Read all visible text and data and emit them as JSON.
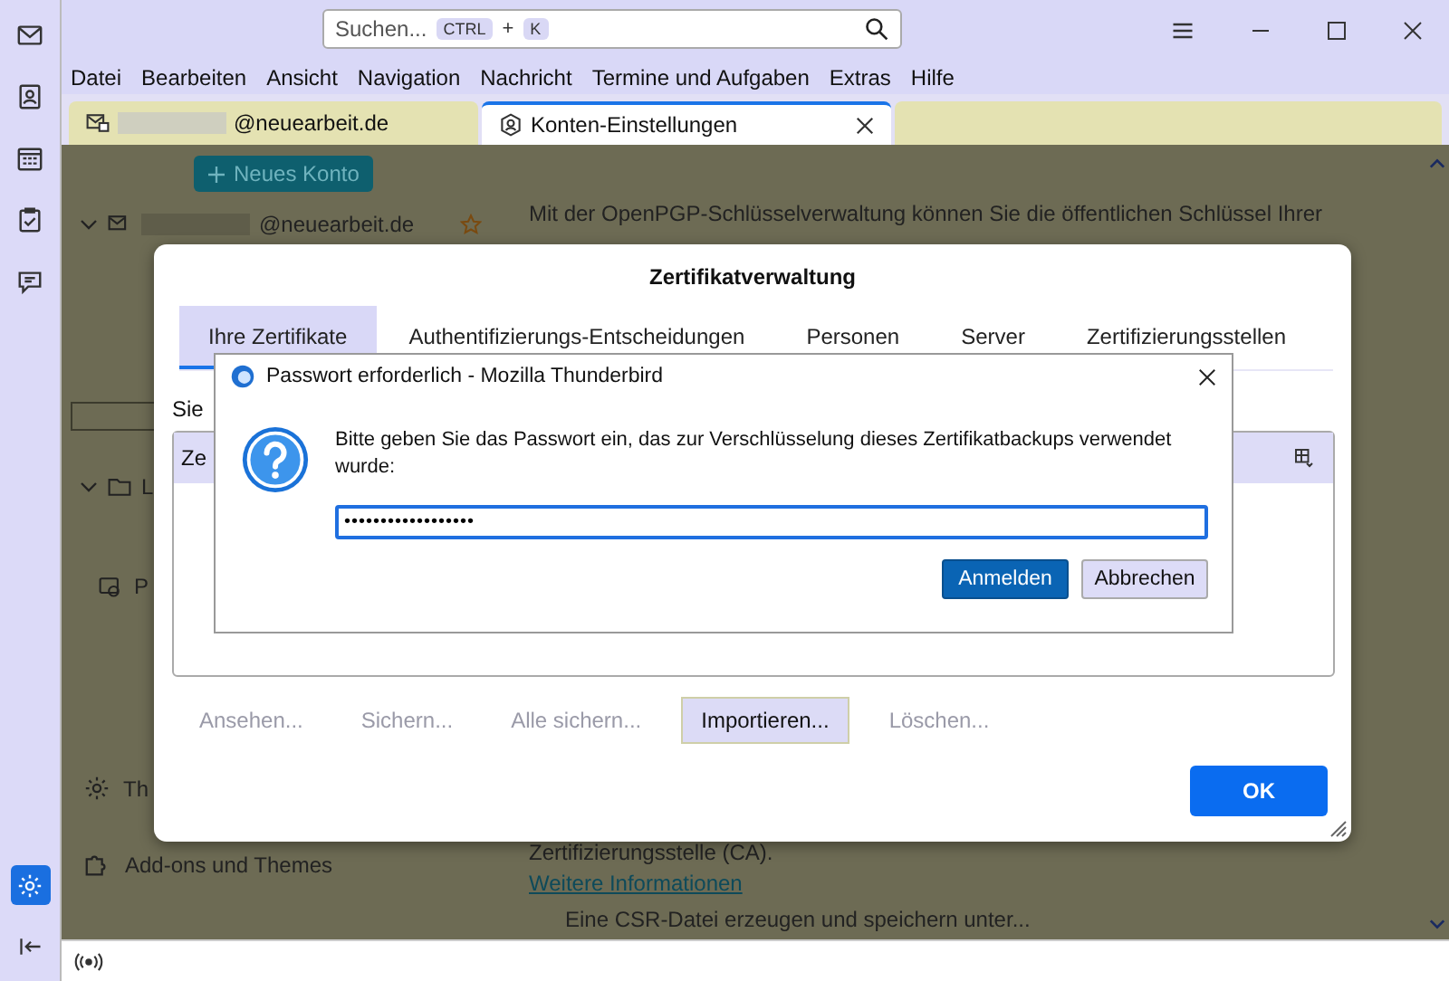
{
  "search": {
    "placeholder": "Suchen...",
    "keys": [
      "CTRL",
      "K"
    ],
    "joiner": "+"
  },
  "menu": [
    {
      "label": "Datei"
    },
    {
      "label": "Bearbeiten"
    },
    {
      "label": "Ansicht"
    },
    {
      "label": "Navigation"
    },
    {
      "label": "Nachricht"
    },
    {
      "label": "Termine und Aufgaben"
    },
    {
      "label": "Extras"
    },
    {
      "label": "Hilfe"
    }
  ],
  "spaces": [
    {
      "selected": false
    },
    {
      "selected": false
    },
    {
      "selected": false
    },
    {
      "selected": false
    },
    {
      "selected": false
    }
  ],
  "settings_space": {
    "selected": true
  },
  "tabs": [
    {
      "label": "@neuearbeit.de",
      "redacted": true,
      "selected": false
    },
    {
      "label": "Konten-Einstellungen",
      "redacted": false,
      "selected": true
    }
  ],
  "account_settings": {
    "new_account": "Neues Konto",
    "account": {
      "label": "@neuearbeit.de",
      "redacted": true,
      "expanded": true
    },
    "folder_label": "L",
    "folder_expanded": true,
    "item_label": "P",
    "intro": "Mit der OpenPGP-Schlüsselverwaltung können Sie die öffentlichen Schlüssel Ihrer",
    "settings_label": "Th",
    "addons_label": "Add-ons und Themes",
    "ca_text": "Zertifizierungsstelle (CA).",
    "more_info": "Weitere Informationen",
    "csr": "Eine CSR-Datei erzeugen und speichern unter..."
  },
  "cert_manager": {
    "title": "Zertifikatverwaltung",
    "tabs": [
      {
        "label": "Ihre Zertifikate",
        "selected": true
      },
      {
        "label": "Authentifizierungs-Entscheidungen",
        "selected": false
      },
      {
        "label": "Personen",
        "selected": false
      },
      {
        "label": "Server",
        "selected": false
      },
      {
        "label": "Zertifizierungsstellen",
        "selected": false
      }
    ],
    "description": "Sie",
    "column": "Ze",
    "buttons": [
      {
        "label": "Ansehen...",
        "disabled": true
      },
      {
        "label": "Sichern...",
        "disabled": true
      },
      {
        "label": "Alle sichern...",
        "disabled": true
      },
      {
        "label": "Importieren...",
        "disabled": false
      },
      {
        "label": "Löschen...",
        "disabled": true
      }
    ],
    "ok": "OK"
  },
  "password_dialog": {
    "title": "Passwort erforderlich - Mozilla Thunderbird",
    "message": "Bitte geben Sie das Passwort ein, das zur Verschlüsselung dieses Zertifikatbackups verwendet wurde:",
    "password": "••••••••••••••••••",
    "buttons": [
      {
        "label": "Anmelden",
        "default": true
      },
      {
        "label": "Abbrechen",
        "default": false
      }
    ]
  }
}
